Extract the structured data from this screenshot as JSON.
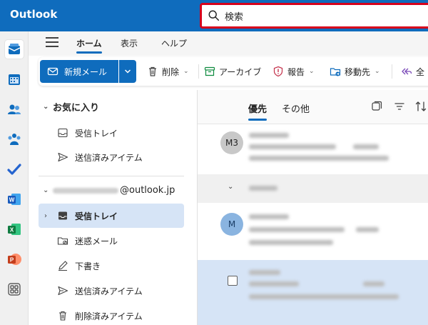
{
  "app": {
    "title": "Outlook"
  },
  "search": {
    "placeholder": "検索"
  },
  "tabs": [
    {
      "label": "ホーム",
      "active": true
    },
    {
      "label": "表示"
    },
    {
      "label": "ヘルプ"
    }
  ],
  "ribbon": {
    "new_mail": "新規メール",
    "delete": "削除",
    "archive": "アーカイブ",
    "report": "報告",
    "move_to": "移動先",
    "reply_all_partial": "全"
  },
  "folders": {
    "favorites_header": "お気に入り",
    "favorites": [
      {
        "label": "受信トレイ",
        "icon": "inbox-icon"
      },
      {
        "label": "送信済みアイテム",
        "icon": "sent-icon"
      }
    ],
    "account_domain": "@outlook.jp",
    "account_items": [
      {
        "label": "受信トレイ",
        "icon": "inbox-icon",
        "selected": true
      },
      {
        "label": "迷惑メール",
        "icon": "junk-icon"
      },
      {
        "label": "下書き",
        "icon": "drafts-icon"
      },
      {
        "label": "送信済みアイテム",
        "icon": "sent-icon"
      },
      {
        "label": "削除済みアイテム",
        "icon": "trash-icon"
      }
    ]
  },
  "message_list": {
    "tab_focused": "優先",
    "tab_other": "その他",
    "messages": [
      {
        "avatar": "M3",
        "avatar_color": "#c8c8c8"
      },
      {
        "avatar": "M",
        "avatar_color": "#8ab4e0"
      }
    ]
  },
  "colors": {
    "brand": "#0f6cbd",
    "search_border": "#d6001c",
    "selected_folder": "#d6e4f6",
    "selected_message": "#d6e4f6"
  }
}
